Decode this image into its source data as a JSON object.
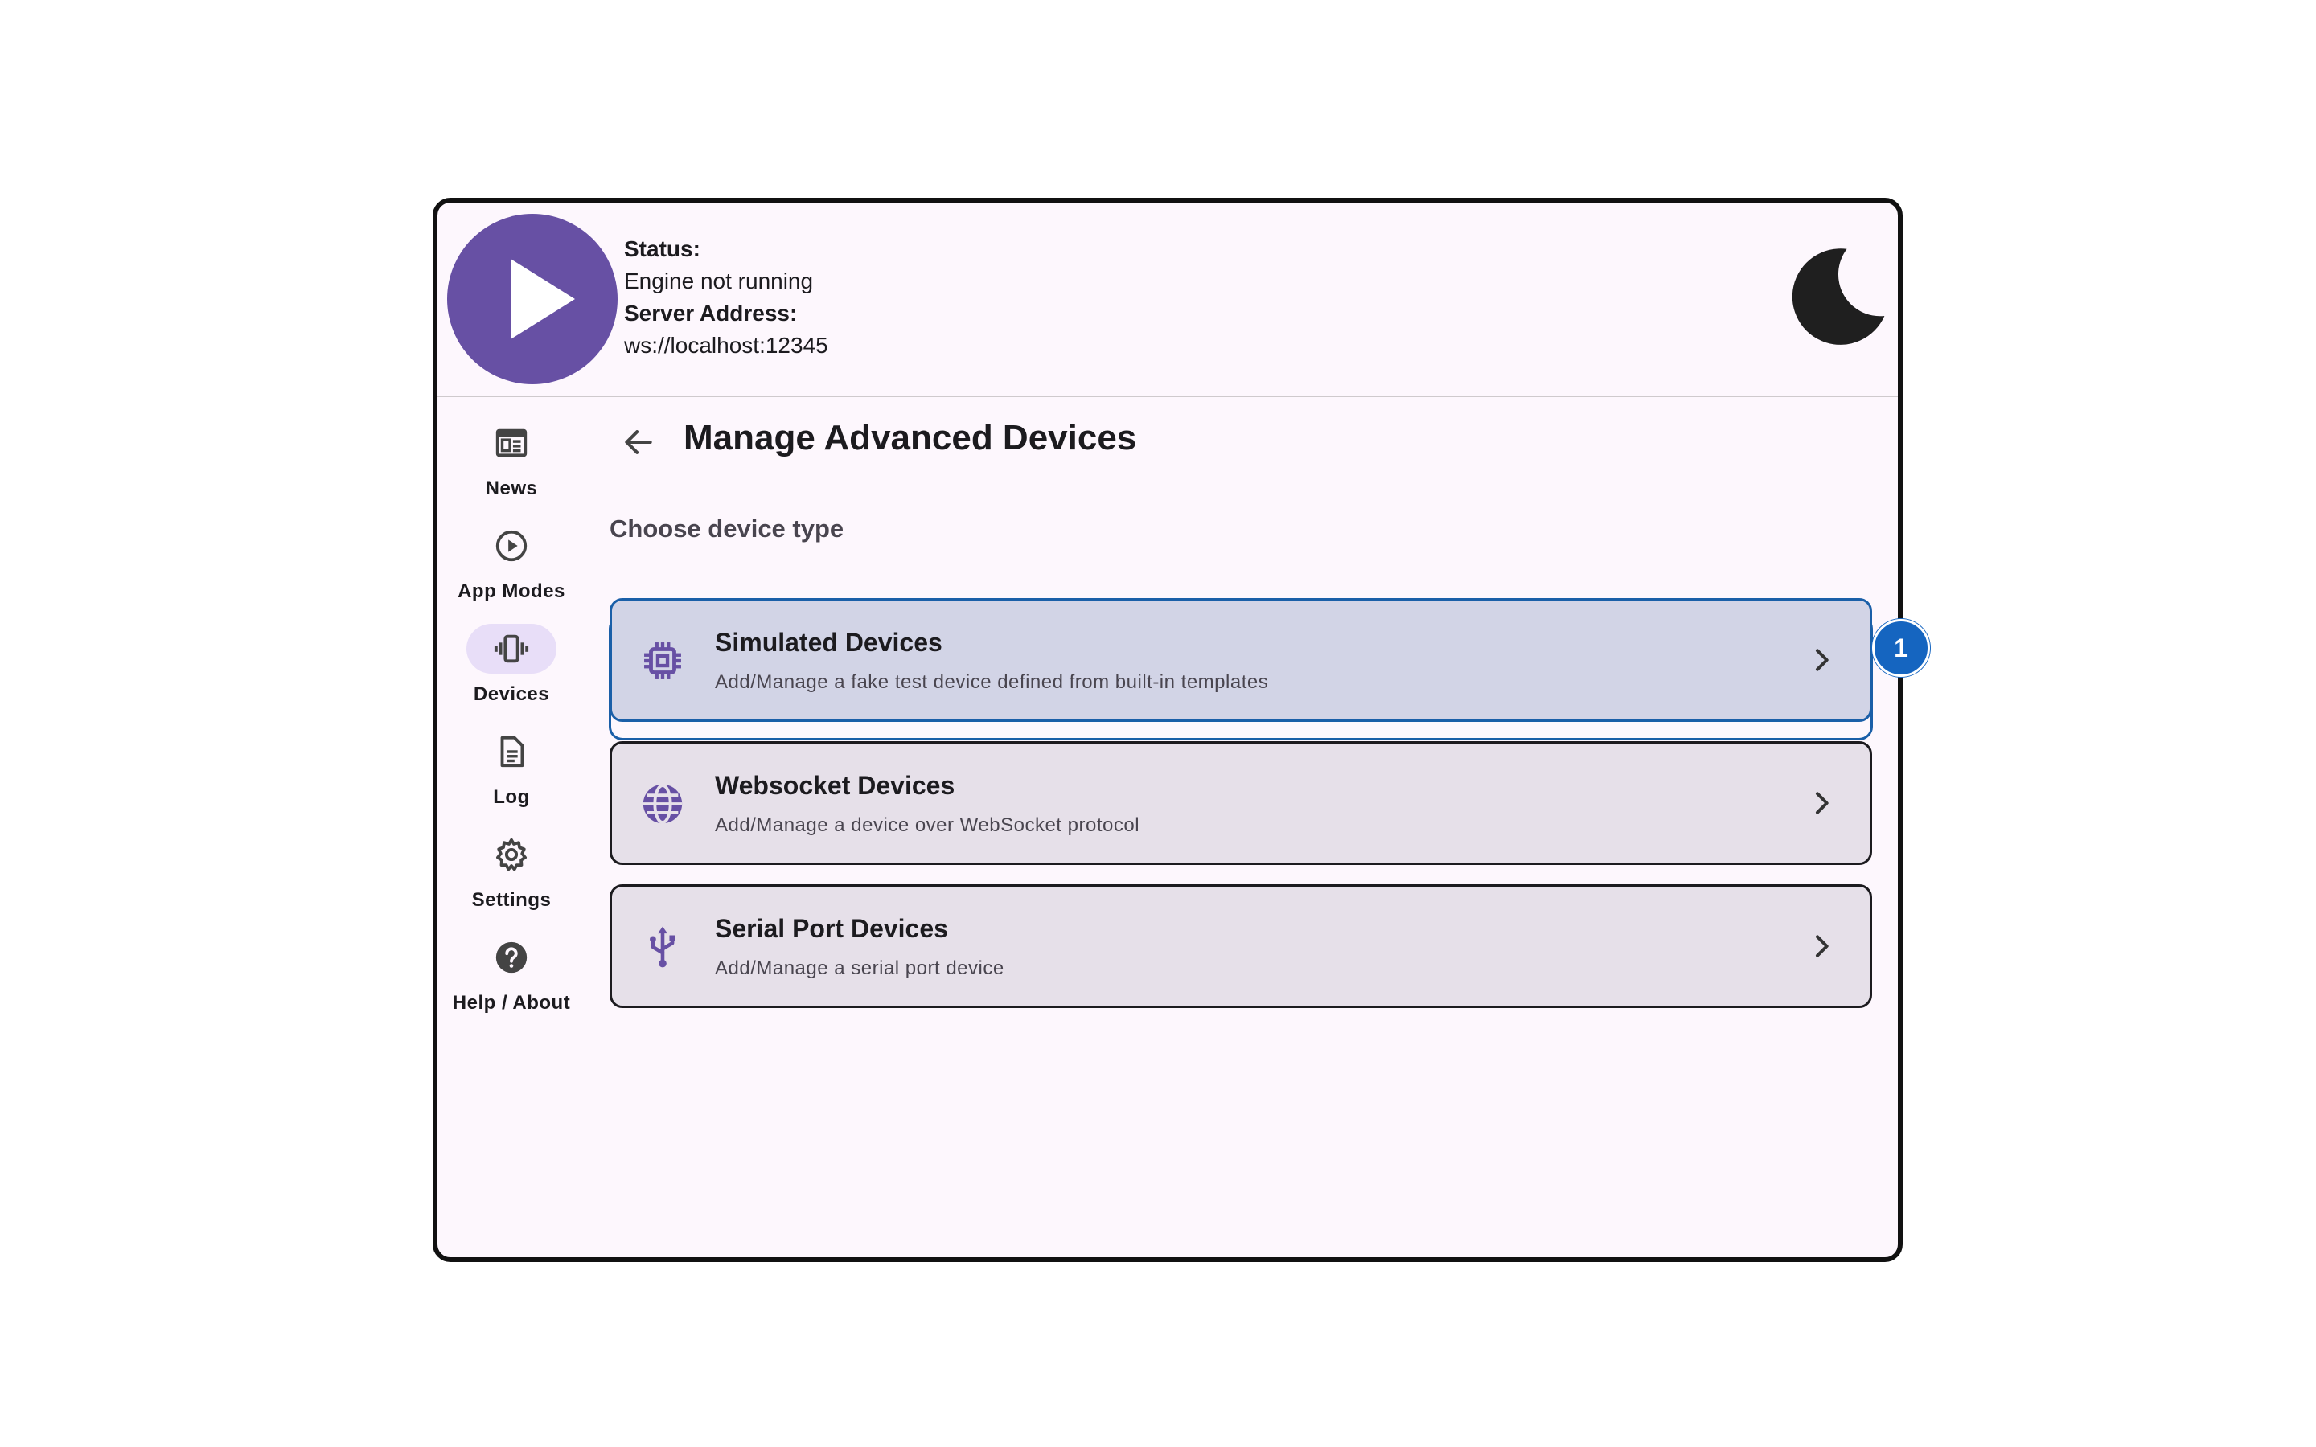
{
  "header": {
    "status_label": "Status:",
    "status_value": "Engine not running",
    "server_label": "Server Address:",
    "server_value": "ws://localhost:12345",
    "play_icon": "play-icon",
    "theme_icon": "moon-icon"
  },
  "sidebar": {
    "items": [
      {
        "label": "News",
        "icon": "newspaper-icon",
        "active": false
      },
      {
        "label": "App Modes",
        "icon": "play-circle-icon",
        "active": false
      },
      {
        "label": "Devices",
        "icon": "vibration-icon",
        "active": true
      },
      {
        "label": "Log",
        "icon": "document-icon",
        "active": false
      },
      {
        "label": "Settings",
        "icon": "gear-icon",
        "active": false
      },
      {
        "label": "Help / About",
        "icon": "help-icon",
        "active": false
      }
    ]
  },
  "main": {
    "title": "Manage Advanced Devices",
    "section_title": "Choose device type",
    "cards": [
      {
        "title": "Simulated Devices",
        "subtitle": "Add/Manage a fake test device defined from built-in templates",
        "icon": "chip-icon",
        "selected": true
      },
      {
        "title": "Websocket Devices",
        "subtitle": "Add/Manage a device over WebSocket protocol",
        "icon": "globe-icon",
        "selected": false
      },
      {
        "title": "Serial Port Devices",
        "subtitle": "Add/Manage a serial port device",
        "icon": "usb-icon",
        "selected": false
      }
    ]
  },
  "annotation": {
    "step_number": "1"
  },
  "colors": {
    "accent": "#6750a4",
    "surface": "#fdf7fd",
    "card": "#e6e0e9",
    "card_selected": "#d2d4e6",
    "badge": "#1565c0"
  }
}
